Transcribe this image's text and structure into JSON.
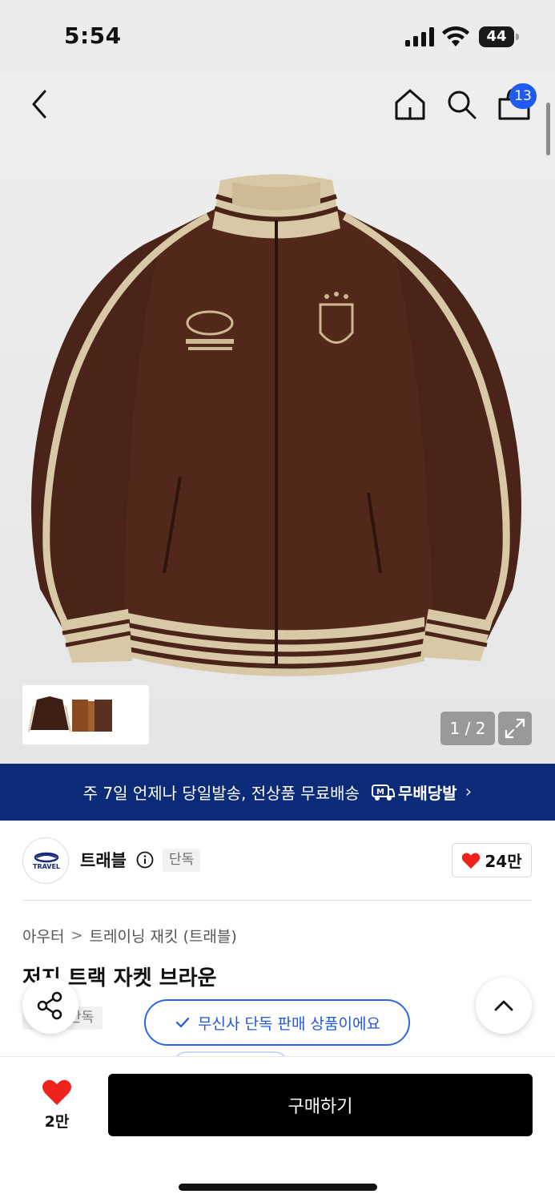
{
  "status_bar": {
    "time": "5:54",
    "battery": "44",
    "icons": [
      "cellular-signal-icon",
      "wifi-icon",
      "battery-icon"
    ]
  },
  "nav": {
    "icons": [
      "back-arrow-icon",
      "home-icon",
      "search-icon",
      "cart-icon"
    ],
    "cart_count": "13"
  },
  "gallery": {
    "pager": "1 / 2",
    "expand_icon": "expand-icon"
  },
  "banner": {
    "text": "주 7일 언제나 당일발송, 전상품 무료배송",
    "logo_text": "무배당발",
    "chevron": "›",
    "color": "#0b2a78"
  },
  "brand": {
    "name": "트래블",
    "tag": "단독",
    "logo_text": "TRAVEL",
    "like_count": "24만"
  },
  "product": {
    "breadcrumb": [
      "아우터",
      "트레이닝 재킷 (트래블)"
    ],
    "breadcrumb_sep": ">",
    "title": "저지 트랙 자켓 브라운",
    "exclusive_tag": "단독"
  },
  "toast": {
    "text": "무신사 단독 판매 상품이에요",
    "accent": "#2f65e8"
  },
  "bottom": {
    "wish_count": "2만",
    "buy_label": "구매하기",
    "heart_color": "#f0221c"
  }
}
